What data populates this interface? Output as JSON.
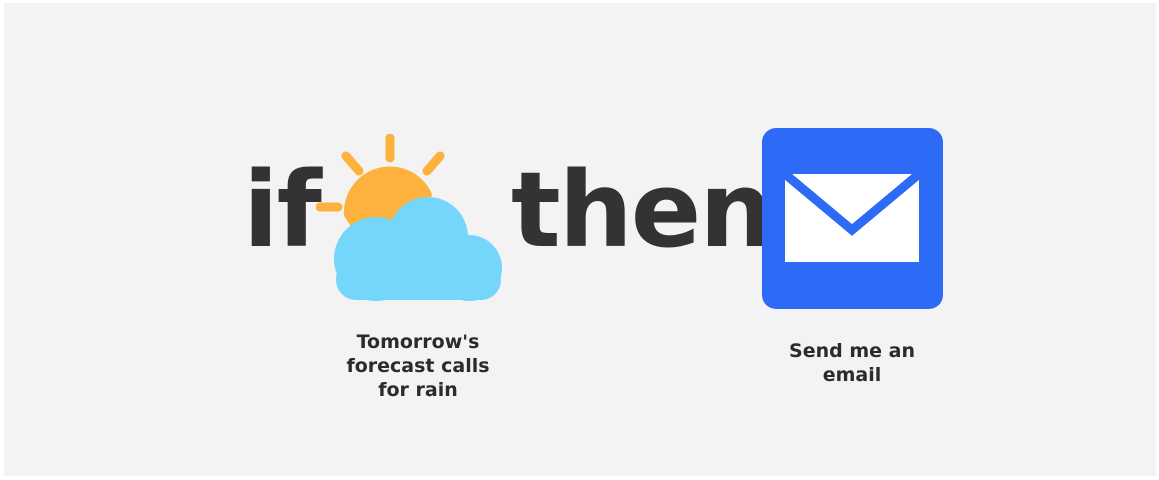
{
  "recipe": {
    "if_word": "if",
    "then_word": "then",
    "trigger": {
      "icon": "sun-behind-cloud-icon",
      "caption_lines": [
        "Tomorrow's",
        "forecast calls",
        "for rain"
      ]
    },
    "action": {
      "icon": "email-envelope-icon",
      "caption_lines": [
        "Send me an",
        "email"
      ]
    }
  },
  "colors": {
    "background": "#f3f3f3",
    "text": "#333333",
    "sun": "#fdb23d",
    "cloud": "#74d6fb",
    "email_tile": "#2d6af6",
    "envelope": "#ffffff"
  }
}
